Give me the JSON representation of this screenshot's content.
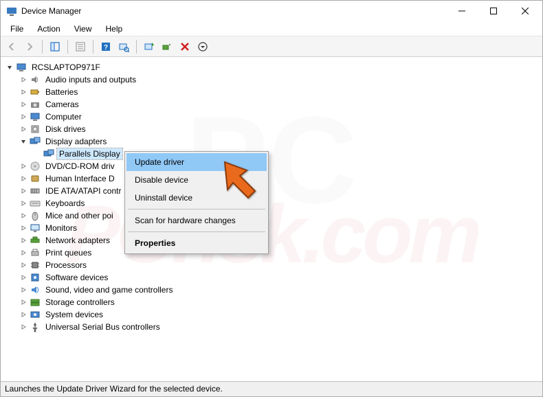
{
  "window": {
    "title": "Device Manager"
  },
  "menu": {
    "items": [
      "File",
      "Action",
      "View",
      "Help"
    ]
  },
  "toolbar": {
    "back": "Back",
    "forward": "Forward",
    "show_hidden": "Show hidden devices",
    "properties": "Properties",
    "help": "Help",
    "scan": "Scan for hardware changes",
    "update": "Update driver",
    "uninstall": "Uninstall device",
    "disable": "Disable device"
  },
  "tree": {
    "root": "RCSLAPTOP971F",
    "categories": [
      {
        "label": "Audio inputs and outputs",
        "icon": "speaker"
      },
      {
        "label": "Batteries",
        "icon": "battery"
      },
      {
        "label": "Cameras",
        "icon": "camera"
      },
      {
        "label": "Computer",
        "icon": "computer"
      },
      {
        "label": "Disk drives",
        "icon": "disk"
      },
      {
        "label": "Display adapters",
        "icon": "display",
        "expanded": true,
        "children": [
          {
            "label": "Parallels Display Adapter (WDDM)",
            "icon": "display",
            "selected": true,
            "truncated": "Parallels Display"
          }
        ]
      },
      {
        "label": "DVD/CD-ROM drives",
        "icon": "dvd",
        "truncated": "DVD/CD-ROM driv"
      },
      {
        "label": "Human Interface Devices",
        "icon": "hid",
        "truncated": "Human Interface D"
      },
      {
        "label": "IDE ATA/ATAPI controllers",
        "icon": "ide",
        "truncated": "IDE ATA/ATAPI contr"
      },
      {
        "label": "Keyboards",
        "icon": "keyboard"
      },
      {
        "label": "Mice and other pointing devices",
        "icon": "mouse",
        "truncated": "Mice and other poi"
      },
      {
        "label": "Monitors",
        "icon": "monitor"
      },
      {
        "label": "Network adapters",
        "icon": "network"
      },
      {
        "label": "Print queues",
        "icon": "printer"
      },
      {
        "label": "Processors",
        "icon": "cpu"
      },
      {
        "label": "Software devices",
        "icon": "software"
      },
      {
        "label": "Sound, video and game controllers",
        "icon": "sound"
      },
      {
        "label": "Storage controllers",
        "icon": "storage"
      },
      {
        "label": "System devices",
        "icon": "system"
      },
      {
        "label": "Universal Serial Bus controllers",
        "icon": "usb"
      }
    ]
  },
  "context_menu": {
    "items": [
      {
        "label": "Update driver",
        "highlight": true
      },
      {
        "label": "Disable device"
      },
      {
        "label": "Uninstall device"
      },
      {
        "sep": true
      },
      {
        "label": "Scan for hardware changes"
      },
      {
        "sep": true
      },
      {
        "label": "Properties",
        "bold": true
      }
    ]
  },
  "statusbar": {
    "text": "Launches the Update Driver Wizard for the selected device."
  },
  "watermark": {
    "brand1": "PCrisk.com"
  }
}
